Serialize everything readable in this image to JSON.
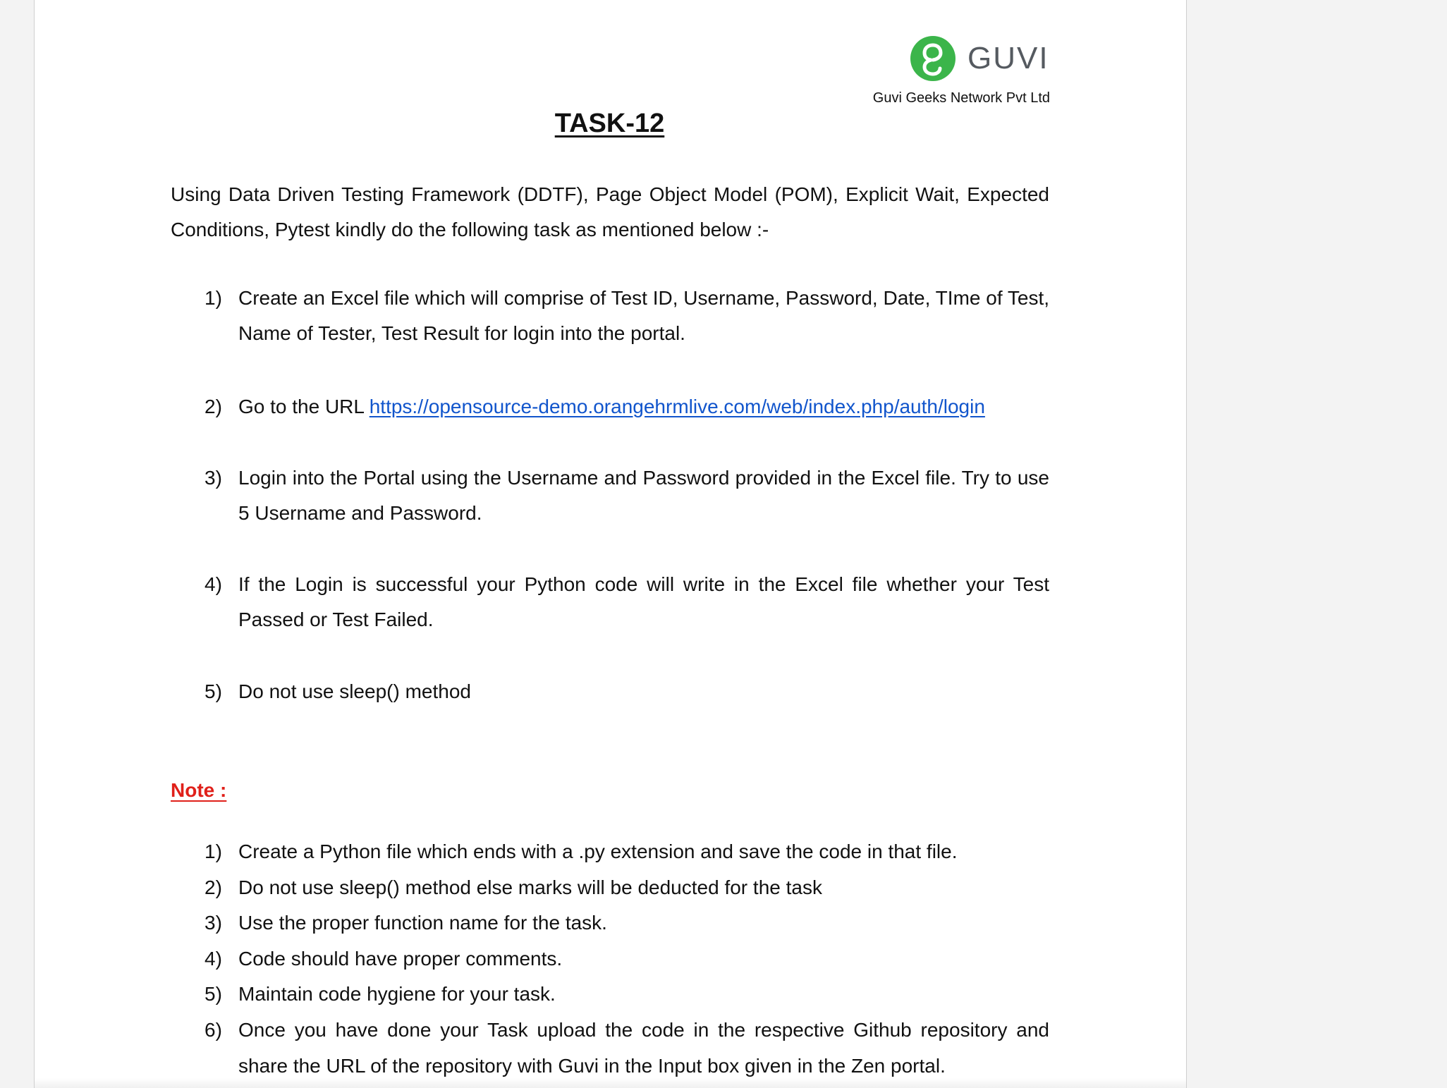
{
  "logo": {
    "brand": "GUVI",
    "company": "Guvi Geeks Network Pvt Ltd",
    "accent_color": "#3bb54a"
  },
  "document": {
    "title": "TASK-12",
    "intro": "Using Data Driven Testing Framework (DDTF), Page Object Model (POM), Explicit Wait, Expected Conditions, Pytest kindly do the following task as mentioned below :-",
    "tasks": [
      {
        "num": "1)",
        "text": "Create an Excel file which will comprise of Test ID, Username, Password, Date, TIme of Test, Name of Tester, Test Result  for login into the portal."
      },
      {
        "num": "2)",
        "prefix": "Go to the URL ",
        "link": "https://opensource-demo.orangehrmlive.com/web/index.php/auth/login"
      },
      {
        "num": "3)",
        "text": "Login into the Portal using the Username and Password provided in the Excel file. Try to use 5 Username and Password."
      },
      {
        "num": "4)",
        "text": "If the Login is successful your Python code will write in the Excel file whether your Test Passed or Test Failed."
      },
      {
        "num": "5)",
        "text": "Do not use sleep() method"
      }
    ],
    "note_label": "Note :",
    "notes": [
      {
        "num": "1)",
        "text": "Create a Python file which ends with a .py extension and save the code in that file."
      },
      {
        "num": "2)",
        "text": "Do not use sleep() method else marks will be deducted for the task"
      },
      {
        "num": "3)",
        "text": "Use the proper function name for the task."
      },
      {
        "num": "4)",
        "text": "Code should have proper comments."
      },
      {
        "num": "5)",
        "text": "Maintain code hygiene for your task."
      },
      {
        "num": "6)",
        "text": "Once you have done your Task upload the code in the respective Github repository and share the URL of the repository with Guvi in the Input box given in the Zen portal."
      }
    ]
  },
  "colors": {
    "link": "#1155cc",
    "note_label": "#e0201a"
  }
}
